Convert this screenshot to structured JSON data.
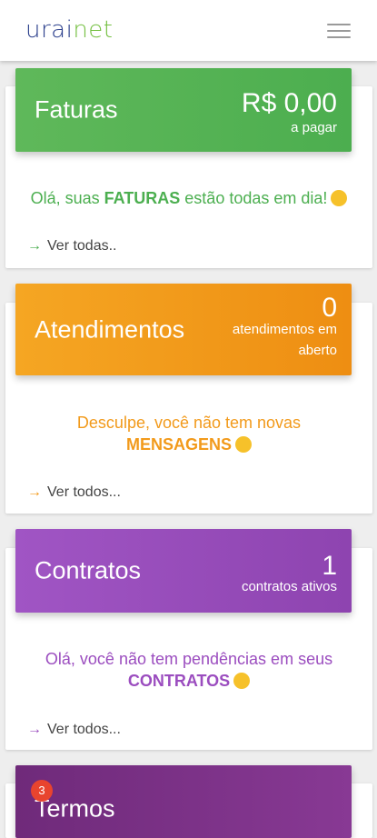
{
  "header": {
    "logo_part1": "urai",
    "logo_part2": "net",
    "menu_icon": "hamburger-menu-icon"
  },
  "cards": {
    "faturas": {
      "title": "Faturas",
      "amount": "R$ 0,00",
      "amount_caption": "a pagar",
      "message_prefix": "Olá, suas ",
      "message_highlight": "FATURAS",
      "message_suffix": " estão todas em dia!",
      "link_label": "Ver todas..",
      "color": "#5cb85c"
    },
    "atendimentos": {
      "title": "Atendimentos",
      "count": "0",
      "caption_line1": "atendimentos em",
      "caption_line2": "aberto",
      "message_prefix": "Desculpe, você não tem novas",
      "message_highlight": "MENSAGENS",
      "link_label": "Ver todos...",
      "color": "#f29a1b"
    },
    "contratos": {
      "title": "Contratos",
      "count": "1",
      "caption": "contratos ativos",
      "message_prefix": "Olá, você não tem pendências em seus",
      "message_highlight": "CONTRATOS",
      "link_label": "Ver todos...",
      "color": "#9b4dbf"
    },
    "termos": {
      "title": "Termos",
      "badge_count": "3",
      "color": "#7b2d83"
    }
  }
}
